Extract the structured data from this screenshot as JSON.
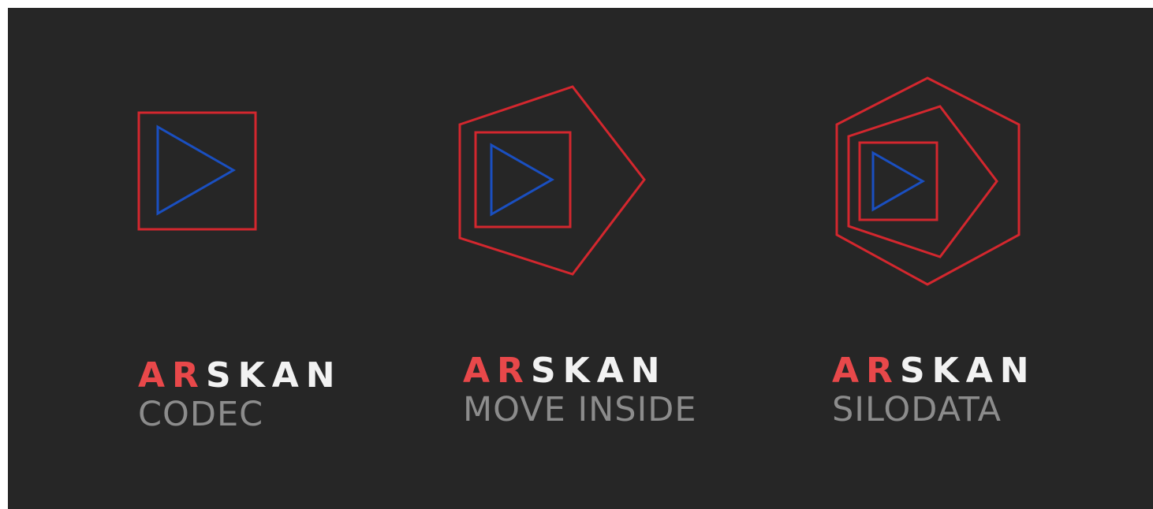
{
  "colors": {
    "background": "#262626",
    "frame": "#d3272e",
    "play": "#1a4fc0",
    "brand_accent": "#e8484a",
    "brand_rest": "#f2f2f2",
    "product": "#8c8c8c"
  },
  "logos": [
    {
      "icon": "square-play-icon",
      "brand_accent": "AR",
      "brand_rest": "SKAN",
      "product": "CODEC"
    },
    {
      "icon": "pentagon-square-play-icon",
      "brand_accent": "AR",
      "brand_rest": "SKAN",
      "product": "MOVE INSIDE"
    },
    {
      "icon": "hexagon-pentagon-square-play-icon",
      "brand_accent": "AR",
      "brand_rest": "SKAN",
      "product": "SILODATA"
    }
  ]
}
